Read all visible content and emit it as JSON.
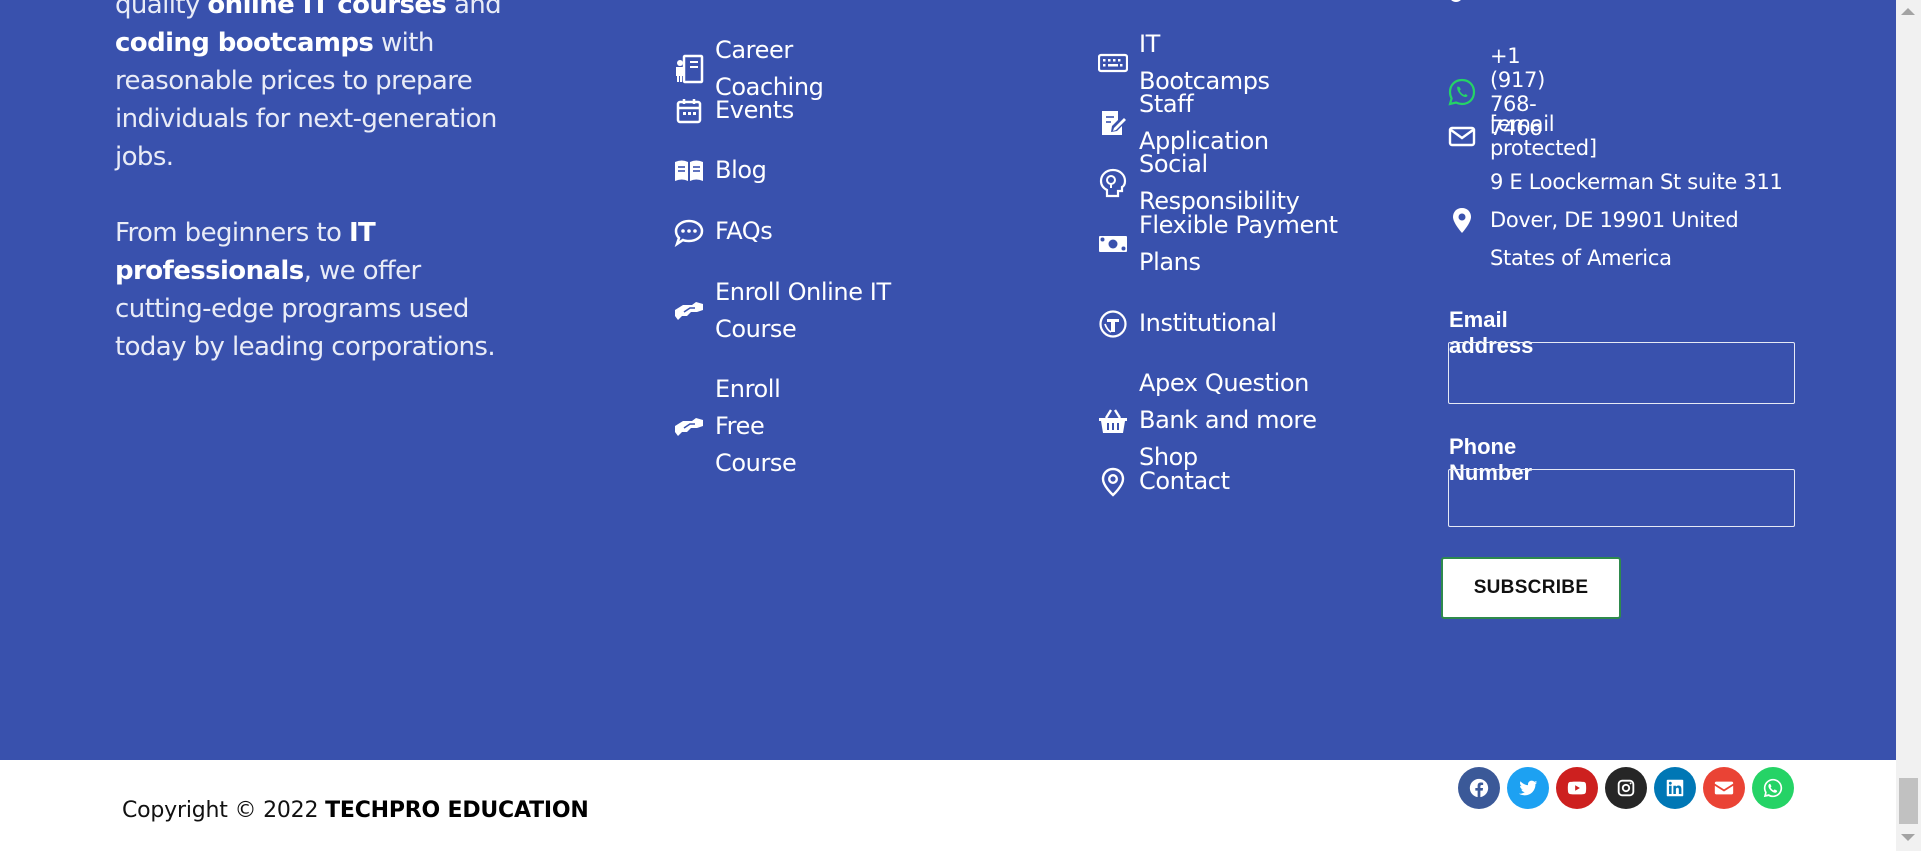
{
  "about": {
    "p1_cut": "quality ",
    "p1_bold1": "online IT courses",
    "p1_mid": " and ",
    "p1_bold2": "coding bootcamps",
    "p1_end": "  with reasonable prices to prepare individuals for next-generation jobs.",
    "p2_start": "From beginners to ",
    "p2_bold": "IT professionals",
    "p2_end": ", we offer cutting-edge programs used today by leading corporations."
  },
  "col_links_1": [
    {
      "label": "Career Coaching",
      "icon": "career-coaching-icon"
    },
    {
      "label": "Events",
      "icon": "calendar-icon"
    },
    {
      "label": "Blog",
      "icon": "book-open-icon"
    },
    {
      "label": "FAQs",
      "icon": "chat-bubble-icon"
    },
    {
      "label": "Enroll Online IT Course",
      "icon": "handshake-icon"
    },
    {
      "label": "Enroll Free Course",
      "icon": "handshake-icon"
    }
  ],
  "col_links_2": [
    {
      "label": "IT Bootcamps",
      "icon": "keyboard-icon"
    },
    {
      "label": "Staff Application",
      "icon": "edit-document-icon"
    },
    {
      "label": "Social Responsibility",
      "icon": "lightbulb-head-icon"
    },
    {
      "label": "Flexible Payment Plans",
      "icon": "money-bill-icon"
    },
    {
      "label": "Institutional",
      "icon": "institution-icon"
    },
    {
      "label": "Apex Question Bank and more Shop",
      "icon": "basket-icon"
    },
    {
      "label": "Contact",
      "icon": "map-pin-icon"
    }
  ],
  "contact": {
    "whatsapp": "+1 (917) 768-7466",
    "email": "[email protected]",
    "address": "9 E Loockerman St suite 311 Dover, DE 19901 United States of America"
  },
  "form": {
    "email_label": "Email address",
    "email_value": "",
    "phone_label": "Phone Number",
    "phone_value": "",
    "subscribe_label": "SUBSCRIBE"
  },
  "copyright": {
    "text": "Copyright © 2022 ",
    "brand": "TECHPRO EDUCATION"
  },
  "social": [
    {
      "name": "facebook-icon",
      "color": "#3b5998"
    },
    {
      "name": "twitter-icon",
      "color": "#1da1f2"
    },
    {
      "name": "youtube-icon",
      "color": "#cd201f"
    },
    {
      "name": "instagram-icon",
      "color": "#262626"
    },
    {
      "name": "linkedin-icon",
      "color": "#0077b5"
    },
    {
      "name": "envelope-icon",
      "color": "#ea4335"
    },
    {
      "name": "whatsapp-icon",
      "color": "#25d366"
    }
  ],
  "colors": {
    "footer_bg": "#3951ad",
    "whatsapp_green": "#25d366"
  }
}
